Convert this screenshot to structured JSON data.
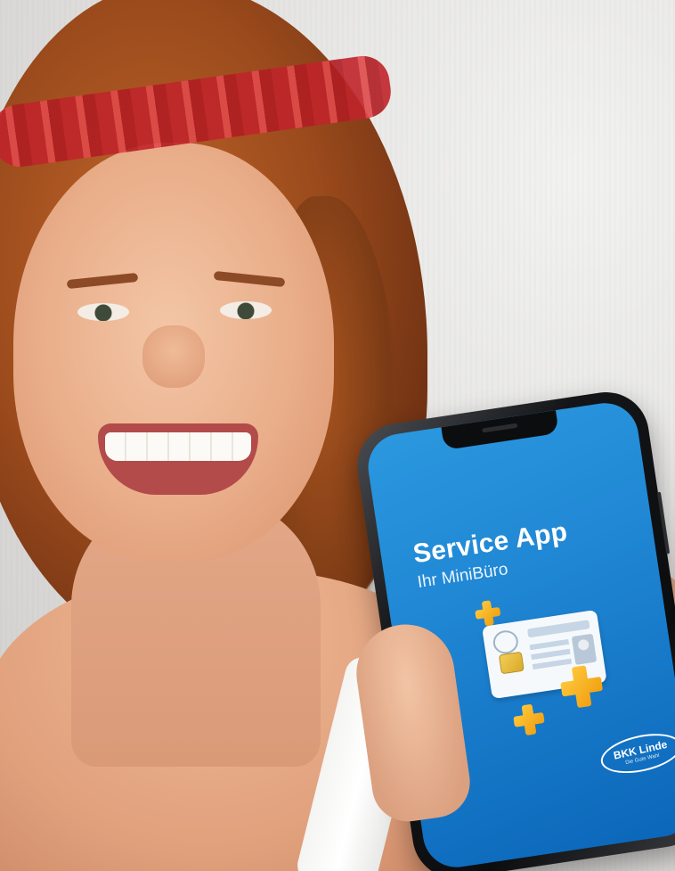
{
  "phone_screen": {
    "title": "Service App",
    "subtitle": "Ihr MiniBüro",
    "background_color": "#1f86d3",
    "accent_color": "#f7b22a",
    "illustration": "health-insurance-card-icon",
    "logo": {
      "name": "BKK Linde",
      "tagline": "Die Gute Wahl"
    }
  }
}
